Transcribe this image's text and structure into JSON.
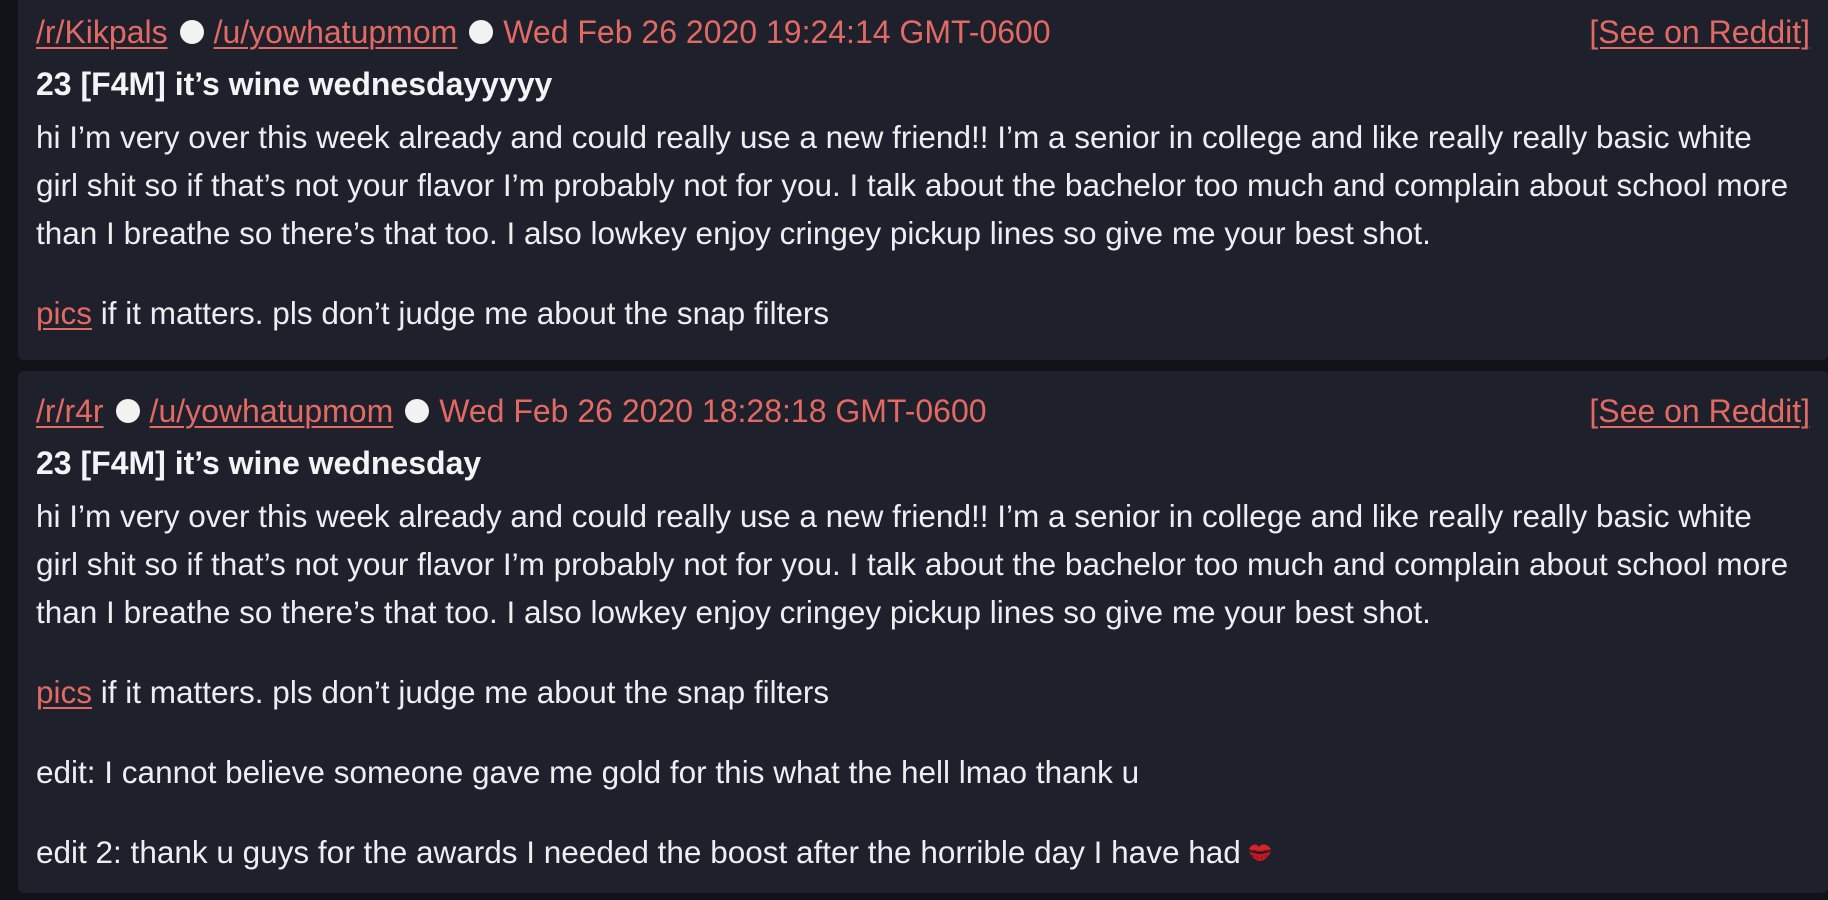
{
  "colors": {
    "background": "#121318",
    "card": "#1e202b",
    "accent": "#e26a63",
    "text": "#eeeef2"
  },
  "posts": [
    {
      "subreddit": "/r/Kikpals",
      "user": "/u/yowhatupmom",
      "date": "Wed Feb 26 2020 19:24:14 GMT-0600",
      "see_link": "[See on Reddit]",
      "title": "23 [F4M] it’s wine wednesdayyyyy",
      "body": "hi I’m very over this week already and could really use a new friend!! I’m a senior in college and like really really basic white girl shit so if that’s not your flavor I’m probably not for you. I talk about the bachelor too much and complain about school more than I breathe so there’s that too. I also lowkey enjoy cringey pickup lines so give me your best shot.",
      "pics_link": "pics",
      "pics_rest": " if it matters. pls don’t judge me about the snap filters"
    },
    {
      "subreddit": "/r/r4r",
      "user": "/u/yowhatupmom",
      "date": "Wed Feb 26 2020 18:28:18 GMT-0600",
      "see_link": "[See on Reddit]",
      "title": "23 [F4M] it’s wine wednesday",
      "body": "hi I’m very over this week already and could really use a new friend!! I’m a senior in college and like really really basic white girl shit so if that’s not your flavor I’m probably not for you. I talk about the bachelor too much and complain about school more than I breathe so there’s that too. I also lowkey enjoy cringey pickup lines so give me your best shot.",
      "pics_link": "pics",
      "pics_rest": " if it matters. pls don’t judge me about the snap filters",
      "edit1": "edit: I cannot believe someone gave me gold for this what the hell lmao thank u",
      "edit2": "edit 2: thank u guys for the awards I needed the boost after the horrible day I have had",
      "edit2_icon": "kiss-mark-icon"
    }
  ]
}
